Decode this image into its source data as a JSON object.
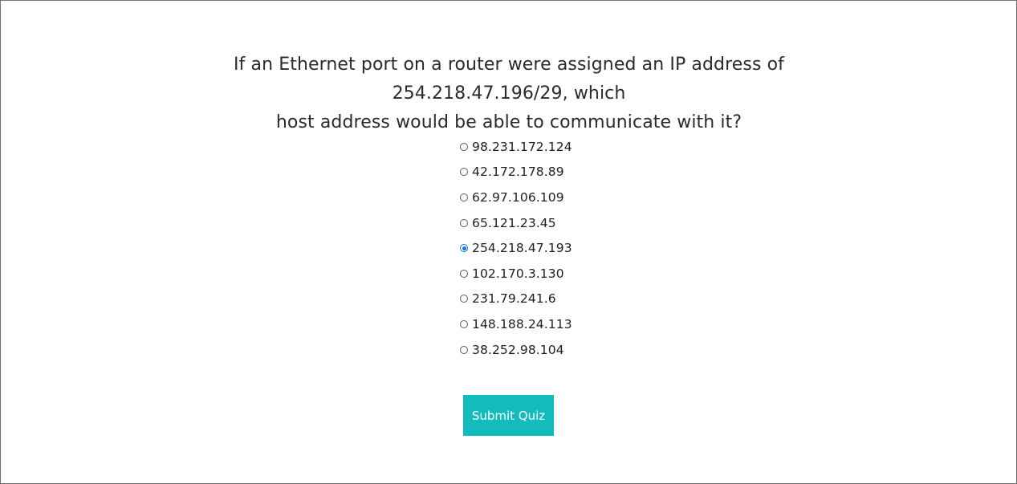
{
  "quiz": {
    "question_line1": "If an Ethernet port on a router were assigned an IP address of 254.218.47.196/29, which",
    "question_line2": "host address would be able to communicate with it?",
    "options": [
      {
        "label": "98.231.172.124",
        "selected": false
      },
      {
        "label": "42.172.178.89",
        "selected": false
      },
      {
        "label": "62.97.106.109",
        "selected": false
      },
      {
        "label": "65.121.23.45",
        "selected": false
      },
      {
        "label": "254.218.47.193",
        "selected": true
      },
      {
        "label": "102.170.3.130",
        "selected": false
      },
      {
        "label": "231.79.241.6",
        "selected": false
      },
      {
        "label": "148.188.24.113",
        "selected": false
      },
      {
        "label": "38.252.98.104",
        "selected": false
      }
    ],
    "submit_label": "Submit Quiz"
  },
  "colors": {
    "accent": "#13bcbc",
    "radio_selected": "#1a73e8"
  }
}
